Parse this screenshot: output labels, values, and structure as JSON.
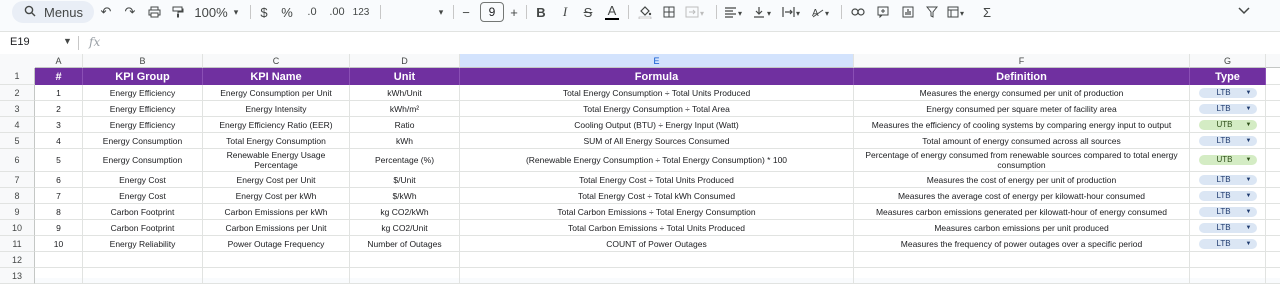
{
  "toolbar": {
    "menus_label": "Menus",
    "zoom": "100%",
    "currency": "$",
    "percent": "%",
    "dec_decrease": ".0",
    "dec_increase": ".00",
    "number_format": "123",
    "font_size": "9",
    "minus": "−",
    "plus": "+",
    "bold": "B",
    "italic": "I",
    "strike": "S",
    "text_color": "A",
    "sum_icon": "Σ"
  },
  "formula_bar": {
    "name_box": "E19",
    "fx": "fx",
    "value": ""
  },
  "columns": [
    "A",
    "B",
    "C",
    "D",
    "E",
    "F",
    "G"
  ],
  "row_numbers": [
    "1",
    "2",
    "3",
    "4",
    "5",
    "6",
    "7",
    "8",
    "9",
    "10",
    "11",
    "12",
    "13"
  ],
  "headers": [
    "#",
    "KPI Group",
    "KPI Name",
    "Unit",
    "Formula",
    "Definition",
    "Type"
  ],
  "rows": [
    [
      "1",
      "Energy Efficiency",
      "Energy Consumption per Unit",
      "kWh/Unit",
      "Total Energy Consumption ÷ Total Units Produced",
      "Measures the energy consumed per unit of production",
      "LTB"
    ],
    [
      "2",
      "Energy Efficiency",
      "Energy Intensity",
      "kWh/m²",
      "Total Energy Consumption ÷ Total Area",
      "Energy consumed per square meter of facility area",
      "LTB"
    ],
    [
      "3",
      "Energy Efficiency",
      "Energy Efficiency Ratio (EER)",
      "Ratio",
      "Cooling Output (BTU) ÷ Energy Input (Watt)",
      "Measures the efficiency of cooling systems by comparing energy input to output",
      "UTB"
    ],
    [
      "4",
      "Energy Consumption",
      "Total Energy Consumption",
      "kWh",
      "SUM of All Energy Sources Consumed",
      "Total amount of energy consumed across all sources",
      "LTB"
    ],
    [
      "5",
      "Energy Consumption",
      "Renewable Energy Usage Percentage",
      "Percentage (%)",
      "(Renewable Energy Consumption ÷ Total Energy Consumption) * 100",
      "Percentage of energy consumed from renewable sources compared to total energy consumption",
      "UTB"
    ],
    [
      "6",
      "Energy Cost",
      "Energy Cost per Unit",
      "$/Unit",
      "Total Energy Cost ÷ Total Units Produced",
      "Measures the cost of energy per unit of production",
      "LTB"
    ],
    [
      "7",
      "Energy Cost",
      "Energy Cost per kWh",
      "$/kWh",
      "Total Energy Cost ÷ Total kWh Consumed",
      "Measures the average cost of energy per kilowatt-hour consumed",
      "LTB"
    ],
    [
      "8",
      "Carbon Footprint",
      "Carbon Emissions per kWh",
      "kg CO2/kWh",
      "Total Carbon Emissions ÷ Total Energy Consumption",
      "Measures carbon emissions generated per kilowatt-hour of energy consumed",
      "LTB"
    ],
    [
      "9",
      "Carbon Footprint",
      "Carbon Emissions per Unit",
      "kg CO2/Unit",
      "Total Carbon Emissions ÷ Total Units Produced",
      "Measures carbon emissions per unit produced",
      "LTB"
    ],
    [
      "10",
      "Energy Reliability",
      "Power Outage Frequency",
      "Number of Outages",
      "COUNT of Power Outages",
      "Measures the frequency of power outages over a specific period",
      "LTB"
    ]
  ],
  "colors": {
    "header_bg": "#7030a0",
    "ltb_chip": "#dbe6f4",
    "utb_chip": "#d4ecc4",
    "selected_col": "#d3e3fd"
  }
}
